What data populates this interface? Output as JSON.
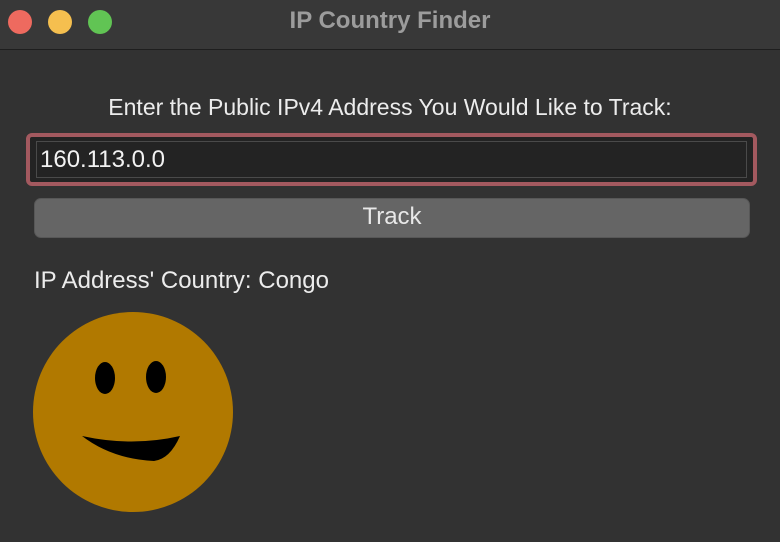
{
  "window": {
    "title": "IP Country Finder"
  },
  "form": {
    "prompt": "Enter the Public IPv4 Address You Would Like to Track:",
    "ip_value": "160.113.0.0",
    "track_label": "Track"
  },
  "result": {
    "text": "IP Address' Country: Congo"
  },
  "image": {
    "icon": "smiley-face-icon",
    "color": "#b17900"
  },
  "colors": {
    "background": "#323232",
    "focus_ring": "#a3595f",
    "button": "#656565"
  }
}
